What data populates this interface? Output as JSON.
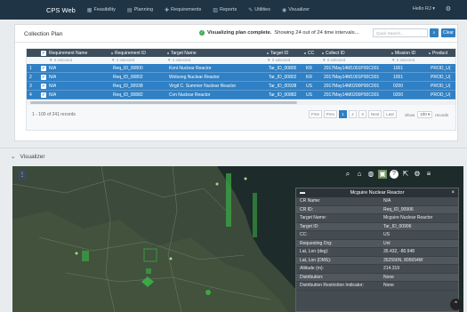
{
  "nav": {
    "brand": "CPS Web",
    "items": [
      {
        "icon": "grid-icon",
        "glyph": "▦",
        "label": "Feasibility"
      },
      {
        "icon": "calendar-icon",
        "glyph": "▤",
        "label": "Planning"
      },
      {
        "icon": "plus-icon",
        "glyph": "✚",
        "label": "Requirements"
      },
      {
        "icon": "document-icon",
        "glyph": "▥",
        "label": "Reports"
      },
      {
        "icon": "wrench-icon",
        "glyph": "✎",
        "label": "Utilities"
      },
      {
        "icon": "eye-icon",
        "glyph": "◉",
        "label": "Visualizer"
      }
    ],
    "user": "Hello RJ ▾"
  },
  "plan": {
    "title": "Collection Plan",
    "status_prefix": "Visualizing plan complete.",
    "status_detail": "Showing 24 out of 24 time intervals...",
    "search_placeholder": "Quick Search...",
    "clear_label": "Clear"
  },
  "table": {
    "columns": [
      "Requirement Name",
      "Requirement ID",
      "Target Name",
      "Target ID",
      "CC",
      "Collect ID",
      "Mission ID",
      "Product"
    ],
    "filter_text": "▼ 0 selected",
    "rows": [
      {
        "idx": "1",
        "req_name": "N/A",
        "req_id": "Req_ID_00800",
        "target": "Koni Nuclear Reactor",
        "target_id": "Tar_ID_00800",
        "cc": "KR",
        "collect_id": "2017May14M1001P00C001",
        "mission_id": "1001",
        "product": "PROD_U("
      },
      {
        "idx": "2",
        "req_name": "N/A",
        "req_id": "Req_ID_00802",
        "target": "Wolsong Nuclear Reactor",
        "target_id": "Tar_ID_00802",
        "cc": "KR",
        "collect_id": "2017May14M1001P00C001",
        "mission_id": "1001",
        "product": "PROD_U("
      },
      {
        "idx": "3",
        "req_name": "N/A",
        "req_id": "Req_ID_00938",
        "target": "Virgil C. Summer Nuclear Reactor",
        "target_id": "Tar_ID_00938",
        "cc": "US",
        "collect_id": "2017May14M0200P00C001",
        "mission_id": "0200",
        "product": "PROD_U("
      },
      {
        "idx": "4",
        "req_name": "N/A",
        "req_id": "Req_ID_00882",
        "target": "Cvn Nuclear Reactor",
        "target_id": "Tar_ID_00882",
        "cc": "US",
        "collect_id": "2017May14M0200P00C001",
        "mission_id": "0200",
        "product": "PROD_U("
      }
    ],
    "records": "1 - 100 of 241 records",
    "pages": [
      "First",
      "Prev",
      "1",
      "2",
      "3",
      "Next",
      "Last"
    ],
    "active_page": "1",
    "per_page_label": "Show",
    "per_page_value": "100 ▾",
    "per_page_suffix": "records"
  },
  "visualizer": {
    "label": "Visualizer",
    "info": {
      "title": "Mcguire Nuclear Reactor",
      "rows": [
        {
          "k": "CR Name:",
          "v": "N/A"
        },
        {
          "k": "CR ID:",
          "v": "Req_ID_00906"
        },
        {
          "k": "Target Name:",
          "v": "Mcguire Nuclear Reactor"
        },
        {
          "k": "Target ID:",
          "v": "Tar_ID_00906"
        },
        {
          "k": "CC:",
          "v": "US"
        },
        {
          "k": "Requesting Org:",
          "v": "Unl"
        },
        {
          "k": "Lat, Lon (deg):",
          "v": "35.432, -80.948"
        },
        {
          "k": "Lat, Lon (DMS):",
          "v": "352556N, 805654W"
        },
        {
          "k": "Altitude (m):",
          "v": "214.319"
        },
        {
          "k": "Distribution:",
          "v": "None"
        },
        {
          "k": "Distribution Restriction Indicator:",
          "v": "None"
        }
      ]
    }
  },
  "colors": {
    "accent": "#2f80c4",
    "nav_bg": "#1f3546",
    "success": "#3bab54",
    "map_overlay": "#3aa845"
  }
}
